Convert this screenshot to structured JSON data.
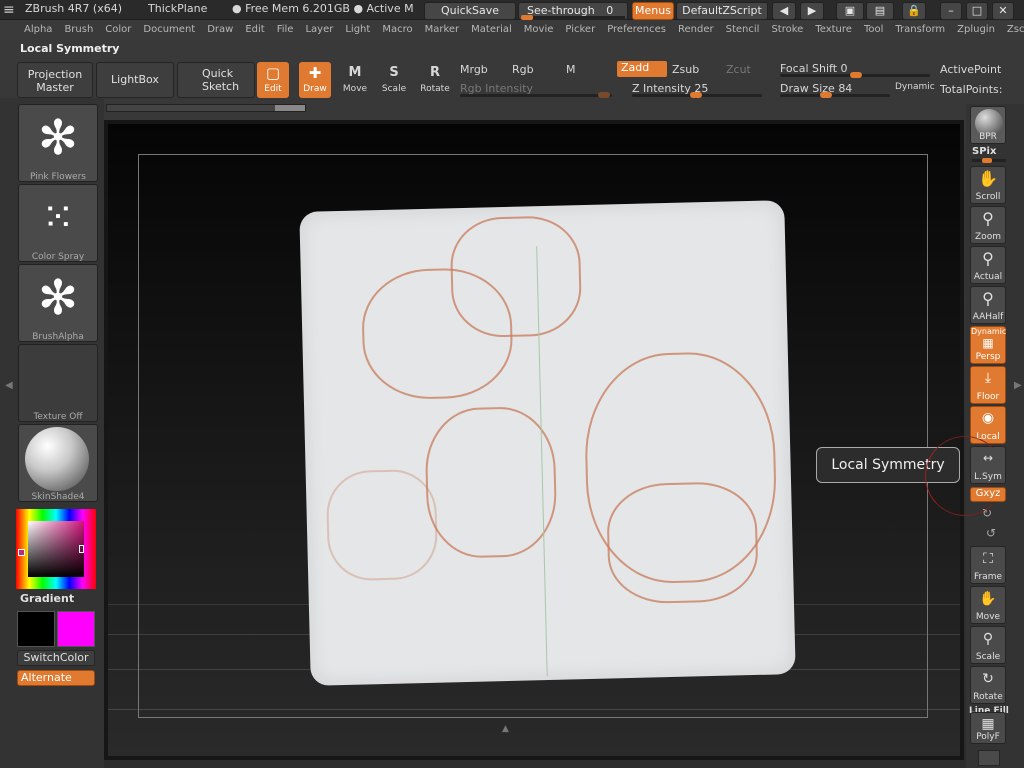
{
  "titlebar": {
    "app": "ZBrush 4R7 (x64)",
    "document": "ThickPlane",
    "mem": "● Free Mem 6.201GB ● Active M",
    "quicksave": "QuickSave",
    "seethrough": "See-through",
    "seethrough_value": "0",
    "menus": "Menus",
    "script": "DefaultZScript"
  },
  "menubar": [
    "Alpha",
    "Brush",
    "Color",
    "Document",
    "Draw",
    "Edit",
    "File",
    "Layer",
    "Light",
    "Macro",
    "Marker",
    "Material",
    "Movie",
    "Picker",
    "Preferences",
    "Render",
    "Stencil",
    "Stroke",
    "Texture",
    "Tool",
    "Transform",
    "Zplugin",
    "Zscript"
  ],
  "palette_title": "Local Symmetry",
  "toolbar": {
    "projection_master": "Projection Master",
    "lightbox": "LightBox",
    "quick_sketch": "Quick Sketch",
    "edit": "Edit",
    "draw": "Draw",
    "move": "Move",
    "scale": "Scale",
    "rotate": "Rotate",
    "mrgb": "Mrgb",
    "rgb": "Rgb",
    "m": "M",
    "zadd": "Zadd",
    "zsub": "Zsub",
    "zcut": "Zcut",
    "rgb_intensity": "Rgb Intensity",
    "z_intensity": "Z Intensity",
    "z_intensity_value": "25",
    "focal_shift": "Focal Shift",
    "focal_shift_value": "0",
    "draw_size": "Draw Size",
    "draw_size_value": "84",
    "dynamic": "Dynamic",
    "active_points": "ActivePoint",
    "total_points": "TotalPoints:"
  },
  "left_panel": {
    "brush": "Pink Flowers",
    "stroke": "Color Spray",
    "alpha": "BrushAlpha",
    "texture": "Texture Off",
    "material": "SkinShade4",
    "gradient": "Gradient",
    "switch_color": "SwitchColor",
    "alternate": "Alternate",
    "colors": {
      "main": "#000000",
      "secondary": "#ff00ff"
    }
  },
  "right_panel": {
    "bpr": "BPR",
    "spix": "SPix",
    "scroll": "Scroll",
    "zoom": "Zoom",
    "actual": "Actual",
    "aahalf": "AAHalf",
    "dynamic_label": "Dynamic",
    "persp": "Persp",
    "floor": "Floor",
    "local": "Local",
    "lsym": "L.Sym",
    "xyz": "Gxyz",
    "frame": "Frame",
    "move": "Move",
    "scale": "Scale",
    "rotate": "Rotate",
    "line_fill": "Line Fill",
    "polyf": "PolyF"
  },
  "tooltip": "Local Symmetry",
  "accent": "#e07a30"
}
